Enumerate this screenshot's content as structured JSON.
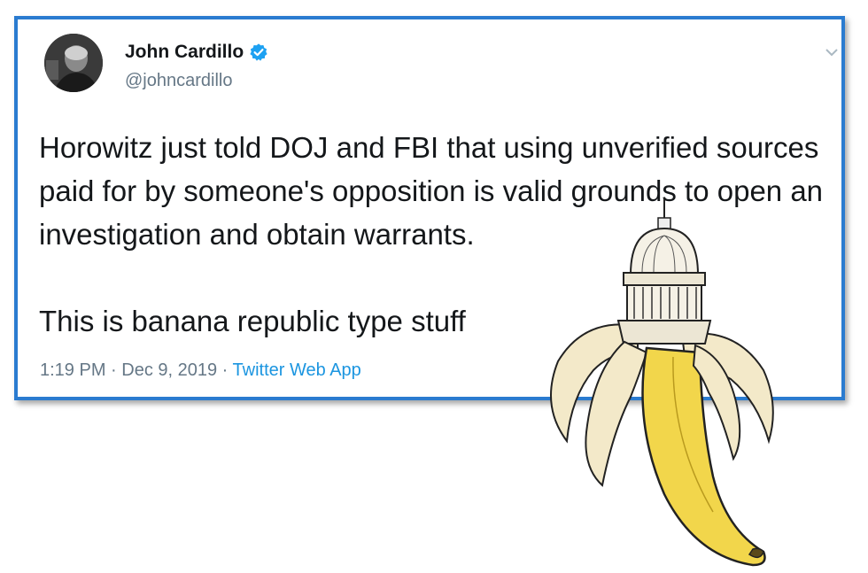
{
  "tweet": {
    "display_name": "John Cardillo",
    "handle": "@johncardillo",
    "text_paragraph_1": "Horowitz just told DOJ and FBI that using unverified sources paid for by someone's opposition is valid grounds to open an investigation and obtain warrants.",
    "text_paragraph_2": "This is banana republic type stuff",
    "time": "1:19 PM",
    "separator": " · ",
    "date": "Dec 9, 2019",
    "source": "Twitter Web App"
  },
  "icons": {
    "verified": "verified-badge-icon",
    "caret": "chevron-down-icon"
  },
  "colors": {
    "frame_border": "#2a7bd0",
    "verified_blue": "#1da1f2",
    "link_blue": "#1b95e0",
    "secondary_text": "#657786",
    "banana_yellow": "#f2d64b"
  }
}
